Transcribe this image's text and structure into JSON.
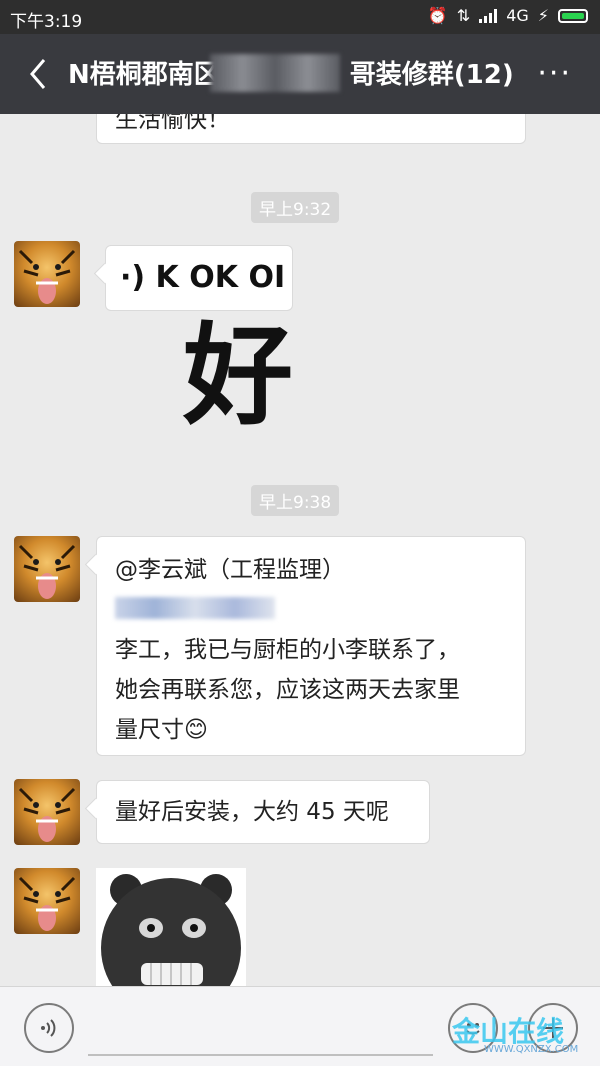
{
  "status_bar": {
    "time": "下午3:19",
    "network": "4G"
  },
  "header": {
    "title_left": "N梧桐郡南区",
    "title_right": "哥装修群(12)",
    "more_label": "···"
  },
  "messages": {
    "top_partial_text": "生活愉快！",
    "timestamp_1": "早上9:32",
    "voice_text": "·) K  OK  OI",
    "sticker_char": "好",
    "timestamp_2": "早上9:38",
    "mention": "@李云斌（工程监理）",
    "reply_line_1": "李工，我已与厨柜的小李联系了，",
    "reply_line_2": "她会再联系您，应该这两天去家里",
    "reply_line_3": "量尺寸",
    "reply_emoji": "😊",
    "install_text": "量好后安装，大约 45 天呢"
  },
  "watermark": {
    "brand": "金山在线",
    "url": "WWW.QXNZX.COM"
  }
}
